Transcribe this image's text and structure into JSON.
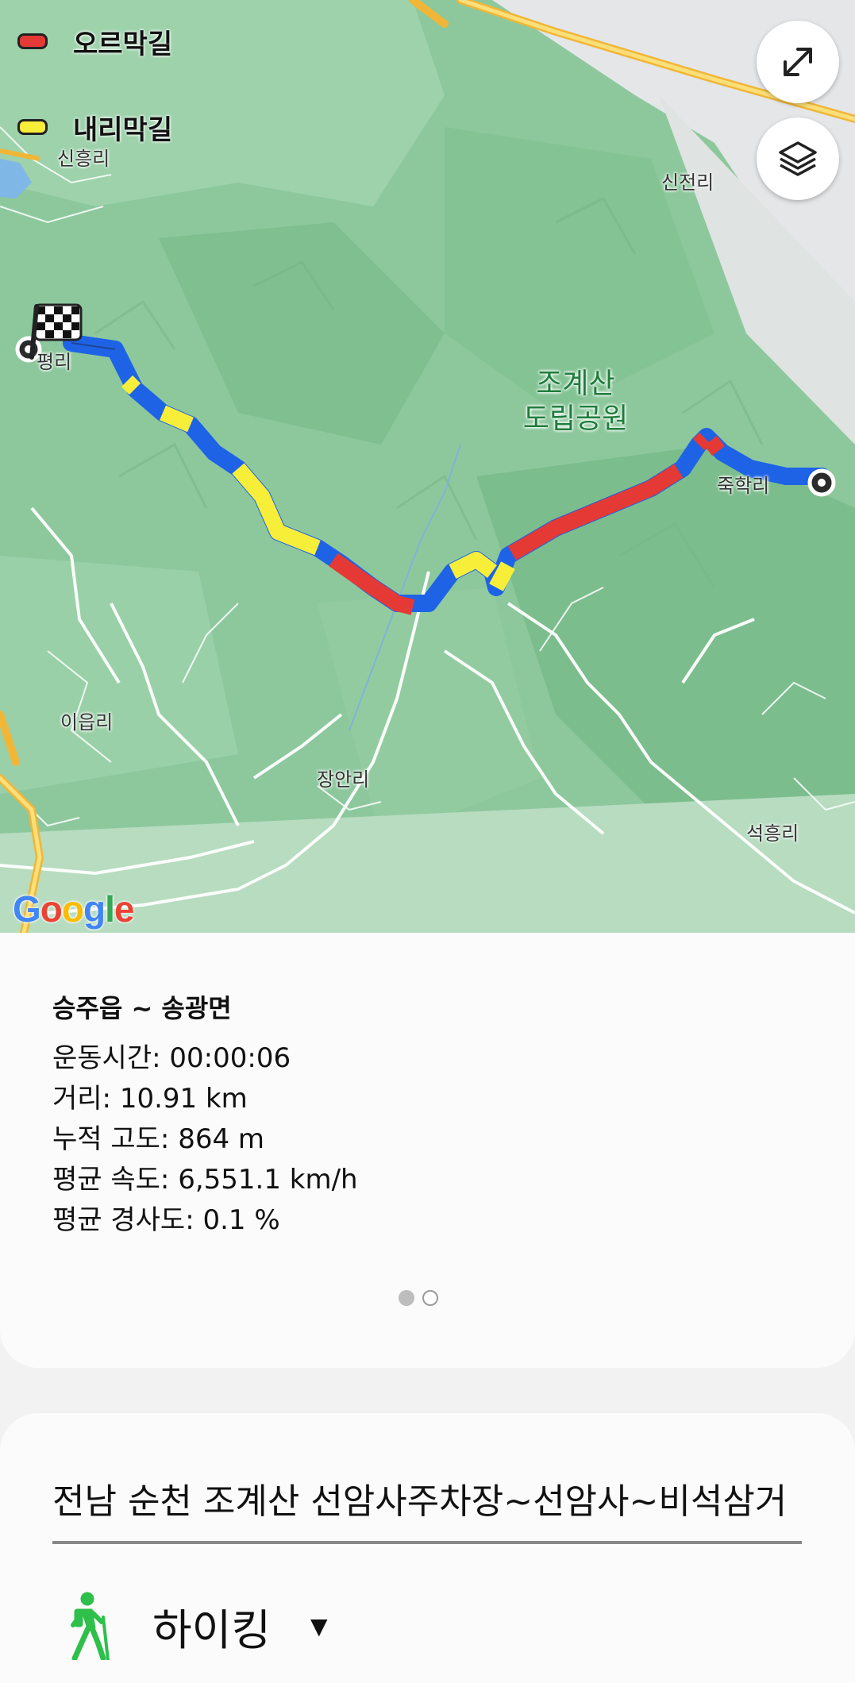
{
  "map": {
    "legend": [
      {
        "label": "오르막길",
        "color": "#e53935"
      },
      {
        "label": "내리막길",
        "color": "#f7ee3a"
      }
    ],
    "places": {
      "sinheung": "신흥리",
      "sinjeon": "신전리",
      "pyeong": "평리",
      "jukhak": "죽학리",
      "ieup": "이읍리",
      "jangan": "장안리",
      "seokheung": "석흥리"
    },
    "park": {
      "line1": "조계산",
      "line2": "도립공원"
    },
    "google": "Google",
    "buttons": {
      "expand_icon": "expand-diagonal-icon",
      "layers_icon": "layers-icon"
    },
    "track_colors": {
      "flat": "#1e63e6",
      "up": "#e53935",
      "down": "#f7ee3a"
    }
  },
  "info": {
    "title": "승주읍 ~ 송광면",
    "stats": [
      "운동시간: 00:00:06",
      "거리: 10.91 km",
      "누적 고도: 864 m",
      "평균 속도: 6,551.1 km/h",
      "평균 경사도: 0.1 %"
    ],
    "page_count": 2,
    "active_page": 1
  },
  "activity": {
    "route_name": "전남 순천 조계산 선암사주차장~선암사~비석삼거",
    "type_label": "하이킹",
    "type_icon": "hiking-person-icon"
  }
}
